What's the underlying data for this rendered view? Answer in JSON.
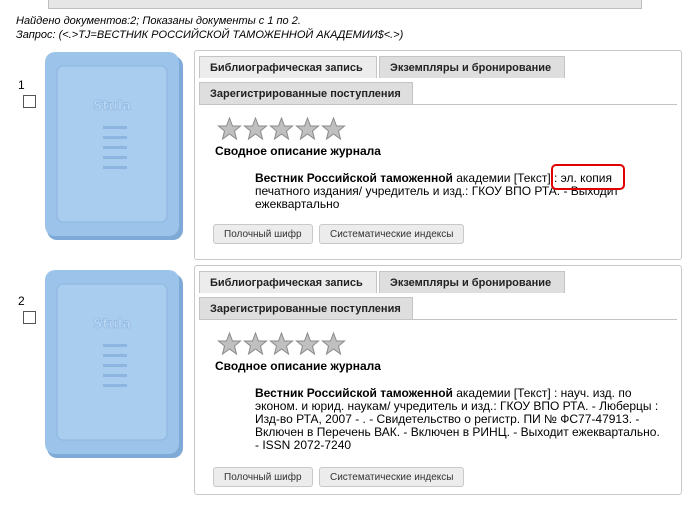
{
  "summary": {
    "found": "Найдено документов:2; Показаны документы с 1 по 2.",
    "query": "Запрос: (<.>TJ=ВЕСТНИК РОССИЙСКОЙ ТАМОЖЕННОЙ АКАДЕМИИ$<.>)"
  },
  "cover_logo": "Stula",
  "records": [
    {
      "number": "1",
      "tabs": [
        "Библиографическая запись",
        "Экземпляры и бронирование",
        "Зарегистрированные поступления"
      ],
      "rating_stars": 5,
      "rating_filled": 0,
      "type_title": "Сводное описание журнала",
      "title_bold": "Вестник Российской таможенной",
      "title_rest": " академии [Текст] : эл. копия печатного издания/ учредитель и изд.: ГКОУ ВПО РТА. - Выходит ежеквартально",
      "buttons": [
        "Полочный шифр",
        "Систематические индексы"
      ]
    },
    {
      "number": "2",
      "tabs": [
        "Библиографическая запись",
        "Экземпляры и бронирование",
        "Зарегистрированные поступления"
      ],
      "rating_stars": 5,
      "rating_filled": 0,
      "type_title": "Сводное описание журнала",
      "title_bold": "Вестник Российской таможенной",
      "title_rest": " академии [Текст] : науч. изд. по эконом. и юрид. наукам/ учредитель и изд.: ГКОУ ВПО РТА. - Люберцы : Изд-во РТА, 2007 - . - Свидетельство о регистр. ПИ № ФС77-47913. - Включен в Перечень ВАК. - Включен в РИНЦ. - Выходит ежеквартально. - ISSN 2072-7240",
      "buttons": [
        "Полочный шифр",
        "Систематические индексы"
      ]
    }
  ],
  "colors": {
    "cover": "#9cc4ea",
    "highlight": "#e00000",
    "star": "#b0b0b0"
  }
}
